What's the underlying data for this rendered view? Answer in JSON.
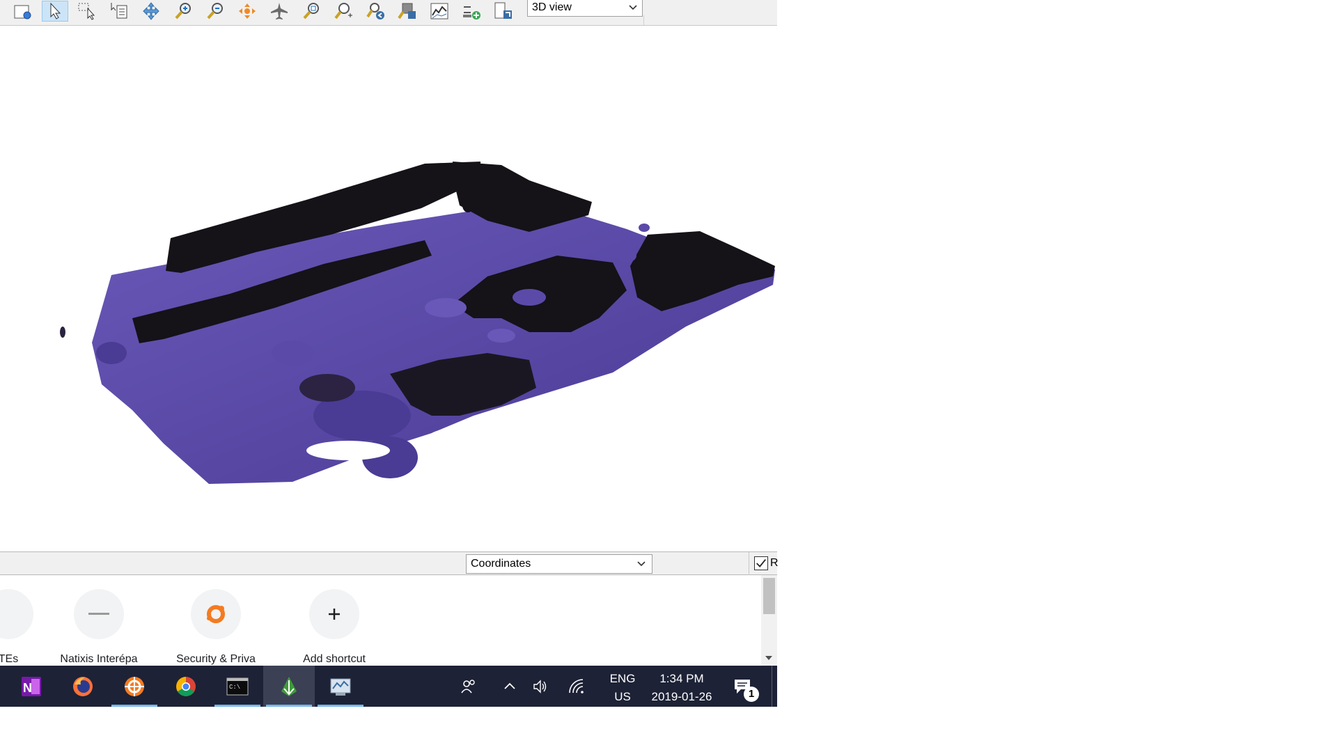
{
  "toolbar": {
    "view_mode": "3D view",
    "tools": [
      "new-view-icon",
      "select-arrow-icon",
      "select-region-icon",
      "identify-icon",
      "pan-icon",
      "zoom-in-icon",
      "zoom-out-icon",
      "orbit-icon",
      "fly-icon",
      "zoom-full-icon",
      "zoom-region-icon",
      "zoom-previous-icon",
      "zoom-next-icon",
      "profile-icon",
      "add-layer-icon",
      "export-icon"
    ]
  },
  "viewport": {
    "surface_color": "#5b4aa8",
    "shadow_color": "#131116"
  },
  "statusbar": {
    "coordinate_mode": "Coordinates",
    "render_label": "R",
    "render_checked": true
  },
  "shortcuts": [
    {
      "label": "TEs",
      "icon": "generic-site-icon"
    },
    {
      "label": "Natixis Interépa",
      "icon": "natixis-icon"
    },
    {
      "label": "Security & Priva",
      "icon": "avast-icon"
    },
    {
      "label": "Add shortcut",
      "icon": "plus-icon"
    }
  ],
  "taskbar": {
    "apps": [
      "onenote-icon",
      "firefox-icon",
      "avast-icon",
      "chrome-icon",
      "terminal-icon",
      "qgis-icon",
      "viewer-app-icon"
    ],
    "language_top": "ENG",
    "language_bottom": "US",
    "time": "1:34 PM",
    "date": "2019-01-26",
    "notification_count": "1"
  }
}
